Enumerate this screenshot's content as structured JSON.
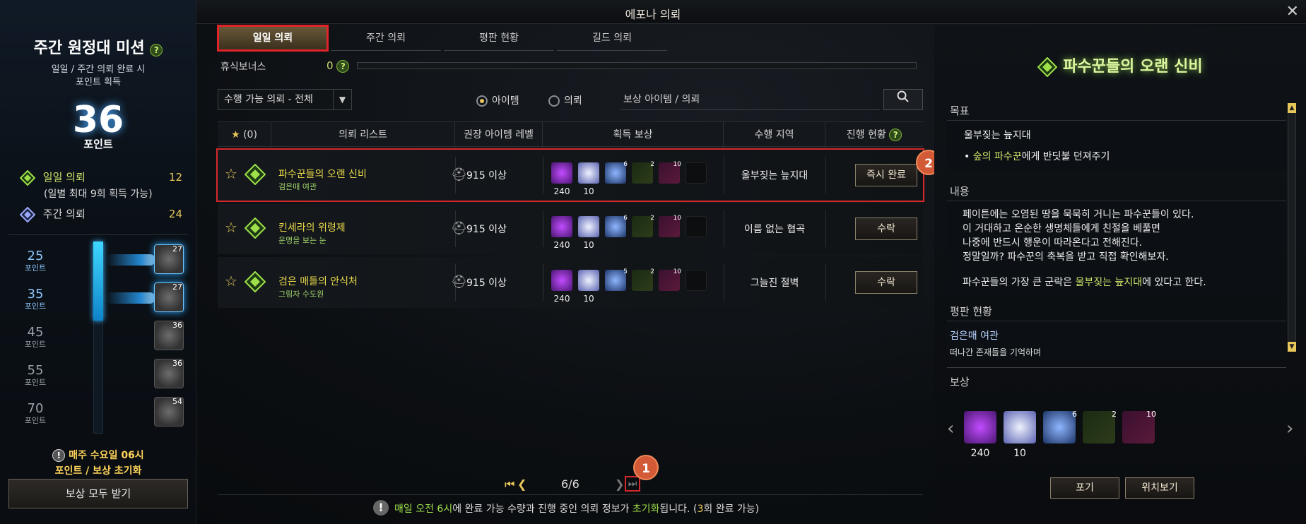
{
  "window": {
    "title": "에포나 의뢰"
  },
  "left": {
    "title": "주간 원정대 미션",
    "subtitle1": "일일 / 주간 의뢰 완료 시",
    "subtitle2": "포인트 획득",
    "points": "36",
    "points_label": "포인트",
    "daily_label": "일일 의뢰",
    "daily_count": "12",
    "daily_note": "(일별 최대 9회 획득 가능)",
    "weekly_label": "주간 의뢰",
    "weekly_count": "24",
    "milestones": [
      {
        "value": "25",
        "unit": "포인트",
        "box": "27",
        "reached": true
      },
      {
        "value": "35",
        "unit": "포인트",
        "box": "27",
        "reached": true
      },
      {
        "value": "45",
        "unit": "포인트",
        "box": "36",
        "reached": false
      },
      {
        "value": "55",
        "unit": "포인트",
        "box": "36",
        "reached": false
      },
      {
        "value": "70",
        "unit": "포인트",
        "box": "54",
        "reached": false
      }
    ],
    "progress_fraction": 0.41,
    "reset1": "매주 수요일 06시",
    "reset2": "포인트 / 보상 초기화",
    "claim_all": "보상 모두 받기"
  },
  "tabs": [
    {
      "label": "일일 의뢰",
      "active": true
    },
    {
      "label": "주간 의뢰"
    },
    {
      "label": "평판 현황"
    },
    {
      "label": "길드 의뢰"
    }
  ],
  "rest": {
    "label": "휴식보너스",
    "value": "0"
  },
  "filter": {
    "dropdown": "수행 가능 의뢰 - 전체",
    "radio_item": "아이템",
    "radio_quest": "의뢰",
    "search_placeholder": "보상 아이템 / 의뢰"
  },
  "table": {
    "headers": {
      "fav": "(0)",
      "list": "의뢰 리스트",
      "level": "권장 아이템 레벨",
      "reward": "획득 보상",
      "zone": "수행 지역",
      "status": "진행 현황"
    },
    "rows": [
      {
        "name": "파수꾼들의 오랜 신비",
        "sub": "검은매 여관",
        "level": "915 이상",
        "r1": "240",
        "r2": "10",
        "c3": "6",
        "c4": "2",
        "c5": "10",
        "zone": "울부짖는 늪지대",
        "button": "즉시 완료"
      },
      {
        "name": "킨세라의 위령제",
        "sub": "운명을 보는 눈",
        "level": "915 이상",
        "r1": "240",
        "r2": "10",
        "c3": "6",
        "c4": "2",
        "c5": "10",
        "zone": "이름 없는 협곡",
        "button": "수락"
      },
      {
        "name": "검은 매들의 안식처",
        "sub": "그림자 수도원",
        "level": "915 이상",
        "r1": "240",
        "r2": "10",
        "c3": "5",
        "c4": "2",
        "c5": "10",
        "zone": "그늘진 절벽",
        "button": "수락"
      }
    ]
  },
  "pager": {
    "text": "6/6"
  },
  "annotations": {
    "b1": "1",
    "b2": "2"
  },
  "notice": {
    "p1": "매일 오전 6시",
    "p2": "에 완료 가능 수량과 진행 중인 의뢰 정보가 ",
    "p3": "초기화",
    "p4": "됩니다. (",
    "p5": "3",
    "p6": "회 완료 가능)"
  },
  "detail": {
    "title": "파수꾼들의 오랜 신비",
    "goal_label": "목표",
    "goal_zone": "울부짖는 늪지대",
    "goal_item_a": "숲의 파수꾼",
    "goal_item_b": "에게 반딧불 던져주기",
    "content_label": "내용",
    "line1": "페이튼에는 오염된 땅을 묵묵히 거니는 파수꾼들이 있다.",
    "line2": "이 거대하고 온순한 생명체들에게 친절을 베풀면",
    "line3": "나중에 반드시 행운이 따라온다고 전해진다.",
    "line4": "정말일까? 파수꾼의 축복을 받고 직접 확인해보자.",
    "line5a": "파수꾼들의 가장 큰 군락은 ",
    "line5b": "울부짖는 늪지대",
    "line5c": "에 있다고 한다.",
    "rep_label": "평판 현황",
    "rep_name": "검은매 여관",
    "rep_desc": "떠나간 존재들을 기억하며",
    "reward_label": "보상",
    "rewards": {
      "r1": "240",
      "r2": "10",
      "c3": "6",
      "c4": "2",
      "c5": "10"
    },
    "abandon": "포기",
    "locate": "위치보기"
  },
  "colors": {
    "accent": "#e8c75a",
    "green": "#9ee04a",
    "highlight_red": "#d8282c",
    "badge": "#d35a36"
  }
}
